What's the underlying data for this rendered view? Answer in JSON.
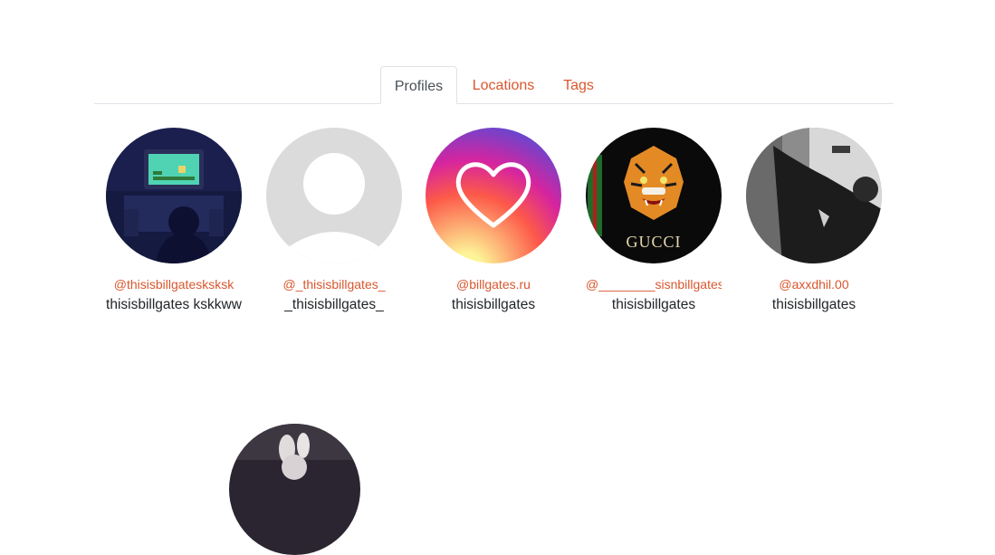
{
  "tabs": [
    {
      "label": "Profiles",
      "active": true
    },
    {
      "label": "Locations",
      "active": false
    },
    {
      "label": "Tags",
      "active": false
    }
  ],
  "profiles": [
    {
      "handle": "@thisisbillgatesksksk",
      "name": "thisisbillgates kskkww",
      "avatar": "retro-gamer-avatar"
    },
    {
      "handle": "@_thisisbillgates_",
      "name": "_thisisbillgates_",
      "avatar": "default-user-avatar"
    },
    {
      "handle": "@billgates.ru",
      "name": "thisisbillgates",
      "avatar": "heart-gradient-avatar"
    },
    {
      "handle": "@________sisnbillgates",
      "name": "thisisbillgates",
      "avatar": "gucci-tiger-avatar"
    },
    {
      "handle": "@axxdhil.00",
      "name": "thisisbillgates",
      "avatar": "grayscale-photo-avatar"
    }
  ],
  "partial_profile": {
    "avatar": "dark-rabbit-avatar"
  },
  "colors": {
    "accent": "#d9572e",
    "text": "#212529",
    "border": "#dee2e6"
  }
}
